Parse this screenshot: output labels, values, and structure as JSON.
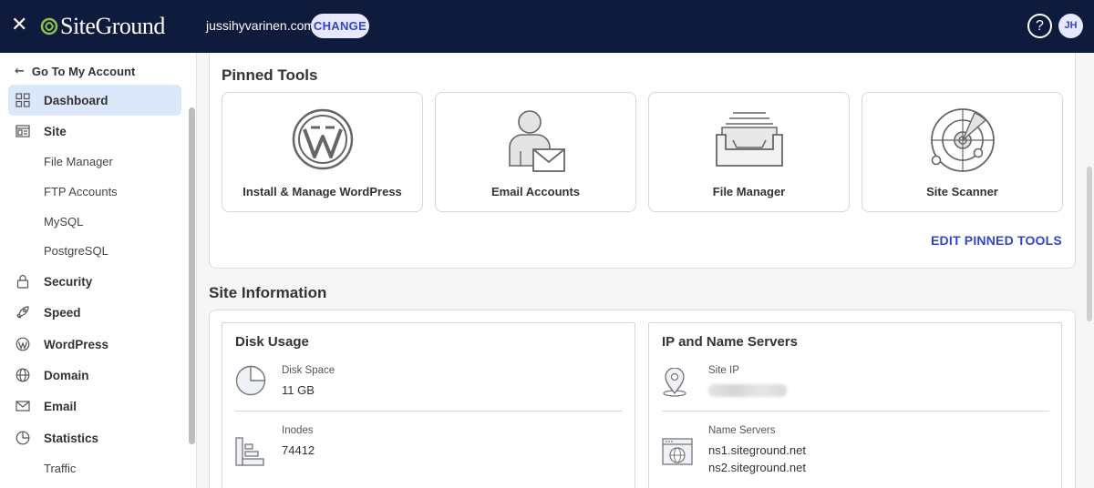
{
  "topbar": {
    "brand": "SiteGround",
    "domain": "jussihyvarinen.com",
    "change_label": "CHANGE",
    "help_label": "?",
    "avatar_initials": "JH",
    "bg_color": "#0f1b3d"
  },
  "sidebar": {
    "back_label": "Go To My Account",
    "items": [
      {
        "label": "Dashboard",
        "icon": "grid-icon",
        "active": true
      },
      {
        "label": "Site",
        "icon": "site-icon"
      },
      {
        "label": "Security",
        "icon": "lock-icon"
      },
      {
        "label": "Speed",
        "icon": "rocket-icon"
      },
      {
        "label": "WordPress",
        "icon": "wordpress-icon"
      },
      {
        "label": "Domain",
        "icon": "globe-icon"
      },
      {
        "label": "Email",
        "icon": "envelope-icon"
      },
      {
        "label": "Statistics",
        "icon": "pie-chart-icon"
      }
    ],
    "site_subitems": [
      "File Manager",
      "FTP Accounts",
      "MySQL",
      "PostgreSQL"
    ],
    "stats_subitems": [
      "Traffic"
    ]
  },
  "pinned": {
    "title": "Pinned Tools",
    "tools": [
      {
        "label": "Install & Manage WordPress",
        "icon": "wordpress-logo-icon"
      },
      {
        "label": "Email Accounts",
        "icon": "email-accounts-icon"
      },
      {
        "label": "File Manager",
        "icon": "file-tray-icon"
      },
      {
        "label": "Site Scanner",
        "icon": "radar-icon"
      }
    ],
    "edit_label": "EDIT PINNED TOOLS"
  },
  "site_info": {
    "title": "Site Information",
    "disk": {
      "title": "Disk Usage",
      "disk_space_label": "Disk Space",
      "disk_space_value": "11 GB",
      "inodes_label": "Inodes",
      "inodes_value": "74412"
    },
    "servers": {
      "title": "IP and Name Servers",
      "site_ip_label": "Site IP",
      "name_servers_label": "Name Servers",
      "ns1": "ns1.siteground.net",
      "ns2": "ns2.siteground.net"
    }
  },
  "colors": {
    "accent": "#3545c8",
    "active_bg": "#dbe8fb",
    "logo_green": "#8bc34a"
  }
}
